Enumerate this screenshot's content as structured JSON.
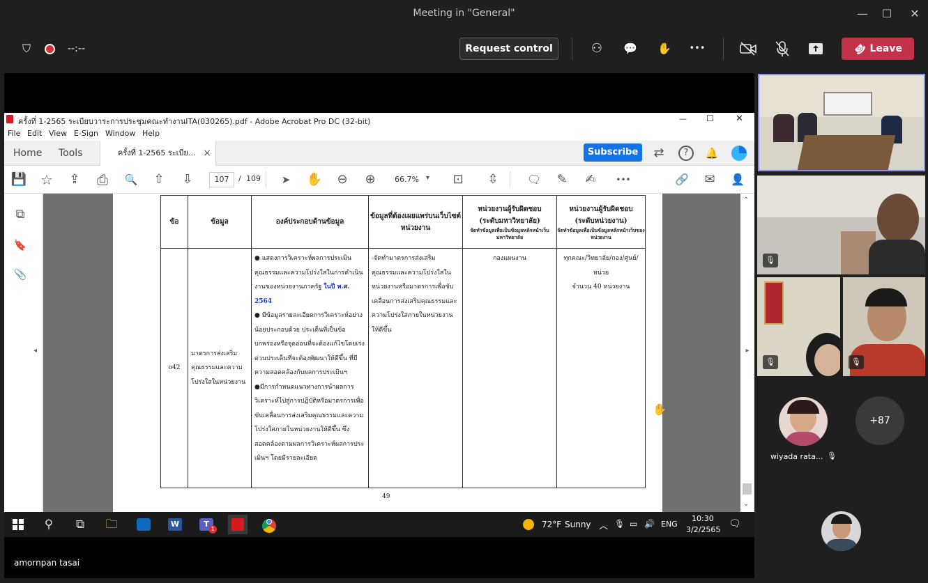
{
  "window": {
    "title": "Meeting in \"General\"",
    "minimize_glyph": "—",
    "maximize_glyph": "☐",
    "close_glyph": "✕"
  },
  "meeting_toolbar": {
    "timer": "--:--",
    "request_control_label": "Request control",
    "leave_label": "Leave",
    "icons": [
      "shield-icon",
      "record-icon",
      "people-icon",
      "chat-icon",
      "raise-hand-icon",
      "more-icon",
      "camera-off-icon",
      "mic-off-icon",
      "share-icon",
      "phone-icon"
    ],
    "glyphs": {
      "shield": "⛉",
      "people": "⚇",
      "chat": "💬",
      "reactions": "✋",
      "more": "•••",
      "camera": "▭",
      "mic": "🎙",
      "share": "⬆",
      "phone": "☎"
    },
    "leave_color": "#c4314b"
  },
  "acrobat": {
    "title": "ครั้งที่ 1-2565 ระเบียบวาระการประชุมคณะทำงานITA(030265).pdf - Adobe Acrobat Pro DC (32-bit)",
    "menu": [
      "File",
      "Edit",
      "View",
      "E-Sign",
      "Window",
      "Help"
    ],
    "tabs": {
      "home": "Home",
      "tools": "Tools",
      "document": "ครั้งที่ 1-2565 ระเบีย...",
      "document_close": "×"
    },
    "subscribe_label": "Subscribe",
    "subscribe_color": "#1473e6",
    "page_current": "107",
    "page_sep": "/",
    "page_total": "109",
    "zoom": "66.7%",
    "zoom_caret": "▾",
    "tool_icons": [
      "save-icon",
      "star-icon",
      "upload-icon",
      "print-icon",
      "search-zoom-icon",
      "page-up-icon",
      "page-down-icon",
      "select-arrow-icon",
      "hand-icon",
      "zoom-out-icon",
      "zoom-in-icon",
      "fit-page-icon",
      "scroll-mode-icon",
      "comment-icon",
      "highlight-icon",
      "sign-icon",
      "more-icon",
      "link-icon",
      "mail-icon",
      "account-icon"
    ],
    "tool_glyphs": {
      "save": "💾",
      "star": "☆",
      "upload": "⇪",
      "print": "⎙",
      "find": "🔍",
      "up": "⇧",
      "down": "⇩",
      "select": "➤",
      "hand": "✋",
      "zoom_out": "⊖",
      "zoom_in": "⊕",
      "fit": "⊡",
      "scroll": "⇳",
      "comment": "🗨",
      "pen": "✎",
      "sign": "✍",
      "more": "•••",
      "link": "🔗",
      "mail": "✉",
      "account": "👤",
      "tab_share": "⇄",
      "help": "?",
      "bell": "🔔",
      "tri_left": "◂",
      "tri_right": "▸",
      "scroll_up": "⌃",
      "scroll_down": "⌄"
    },
    "side_glyphs": {
      "pages": "⧉",
      "bookmark": "🔖",
      "attach": "📎"
    }
  },
  "pdf": {
    "headers": {
      "no": "ข้อ",
      "data": "ข้อมูล",
      "components": "องค์ประกอบด้านข้อมูล",
      "publish": "ข้อมูลที่ต้องเผยแพร่บนเว็บไซต์หน่วยงาน",
      "uni_title": "หน่วยงานผู้รับผิดชอบ",
      "uni_sub": "(ระดับมหาวิทยาลัย)",
      "uni_note": "จัดทำข้อมูลเพื่อเป็นข้อมูลหลักหน้าเว็บมหาวิทยาลัย",
      "unit_title": "หน่วยงานผู้รับผิดชอบ",
      "unit_sub": "(ระดับหน่วยงาน)",
      "unit_note": "จัดทำข้อมูลเพื่อเป็นข้อมูลหลักหน้าเว็บของหน่วยงาน"
    },
    "row": {
      "no": "o42",
      "data": "มาตรการส่งเสริมคุณธรรมและความโปร่งใสในหน่วยงาน",
      "components_1": "● แสดงการวิเคราะห์ผลการประเมินคุณธรรมและความโปร่งใสในการดำเนินงานของหน่วยงานภาครัฐ",
      "components_1_highlight": "ในปี พ.ศ. 2564",
      "components_2": "● มีข้อมูลรายละเอียดการวิเคราะห์อย่างน้อยประกอบด้วย ประเด็นที่เป็นข้อบกพร่องหรือจุดอ่อนที่จะต้องแก้ไขโดยเร่งด่วนประเด็นที่จะต้องพัฒนาให้ดีขึ้น ที่มีความสอดคล้องกับผลการประเมินฯ",
      "components_3": "●มีการกำหนดแนวทางการนำผลการวิเคราะห์ไปสู่การปฏิบัติหรือมาตรการเพื่อขับเคลื่อนการส่งเสริมคุณธรรมและความโปร่งใสภายในหน่วยงานให้ดีขึ้น ซึ่งสอดคล้องตามผลการวิเคราะห์ผลการประเมินฯ โดยมีรายละเอียด",
      "publish": "-จัดทำมาตรการส่งเสริมคุณธรรมและความโปร่งใสในหน่วยงานหรือมาตรการเพื่อขับเคลื่อนการส่งเสริมคุณธรรมและความโปร่งใสภายในหน่วยงานให้ดีขึ้น",
      "uni": "กองแผนงาน",
      "unit_1": "ทุกคณะ/วิทยาลัย/กอง/ศูนย์/หน่วย",
      "unit_2": "จำนวน 40 หน่วยงาน"
    },
    "page_number": "49"
  },
  "taskbar": {
    "weather_temp": "72°F",
    "weather_text": "Sunny",
    "lang": "ENG",
    "time": "10:30",
    "date": "3/2/2565",
    "app_icons": [
      "windows-start-icon",
      "search-icon",
      "task-view-icon",
      "file-explorer-icon",
      "outlook-icon",
      "word-icon",
      "teams-icon",
      "acrobat-icon",
      "chrome-icon"
    ],
    "glyphs": {
      "search": "⚲",
      "taskview": "⧉",
      "folder": "🗀",
      "up": "︿",
      "mic": "🎙",
      "net": "▭",
      "vol": "🔊",
      "notify": "🗨"
    },
    "teams_badge": "1"
  },
  "presenter_name": "amornpan tasai",
  "participants": {
    "more_count": "+87",
    "named": "wiyada rata...",
    "mute_glyph": "🎙"
  }
}
